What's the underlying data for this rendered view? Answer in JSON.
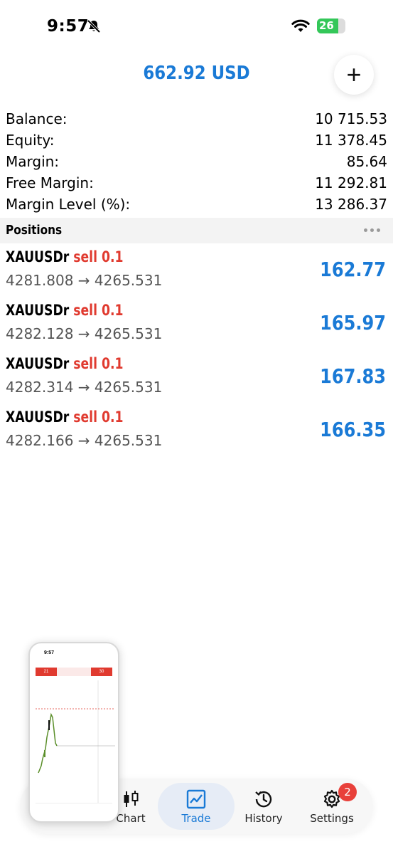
{
  "status_bar": {
    "time": "9:57",
    "battery": "26"
  },
  "header": {
    "title": "662.92 USD",
    "add_label": "+"
  },
  "summary": [
    {
      "label": "Balance:",
      "value": "10 715.53"
    },
    {
      "label": "Equity:",
      "value": "11 378.45"
    },
    {
      "label": "Margin:",
      "value": "85.64"
    },
    {
      "label": "Free Margin:",
      "value": "11 292.81"
    },
    {
      "label": "Margin Level (%):",
      "value": "13 286.37"
    }
  ],
  "positions": {
    "title": "Positions",
    "items": [
      {
        "symbol": "XAUUSDr",
        "side": "sell 0.1",
        "prices": "4281.808 → 4265.531",
        "profit": "162.77"
      },
      {
        "symbol": "XAUUSDr",
        "side": "sell 0.1",
        "prices": "4282.128 → 4265.531",
        "profit": "165.97"
      },
      {
        "symbol": "XAUUSDr",
        "side": "sell 0.1",
        "prices": "4282.314 → 4265.531",
        "profit": "167.83"
      },
      {
        "symbol": "XAUUSDr",
        "side": "sell 0.1",
        "prices": "4282.166 → 4265.531",
        "profit": "166.35"
      }
    ]
  },
  "nav": {
    "items": [
      {
        "label": "Chart",
        "icon": "candlestick-icon"
      },
      {
        "label": "Trade",
        "icon": "trade-chart-icon",
        "active": true
      },
      {
        "label": "History",
        "icon": "history-clock-icon"
      },
      {
        "label": "Settings",
        "icon": "gear-icon"
      }
    ],
    "settings_badge": "2"
  },
  "pip": {
    "time": "9:57",
    "sell_price": "21",
    "buy_price": "30"
  },
  "colors": {
    "accent": "#1a7ad6",
    "sell": "#e03a2f",
    "badge": "#e8403a"
  }
}
